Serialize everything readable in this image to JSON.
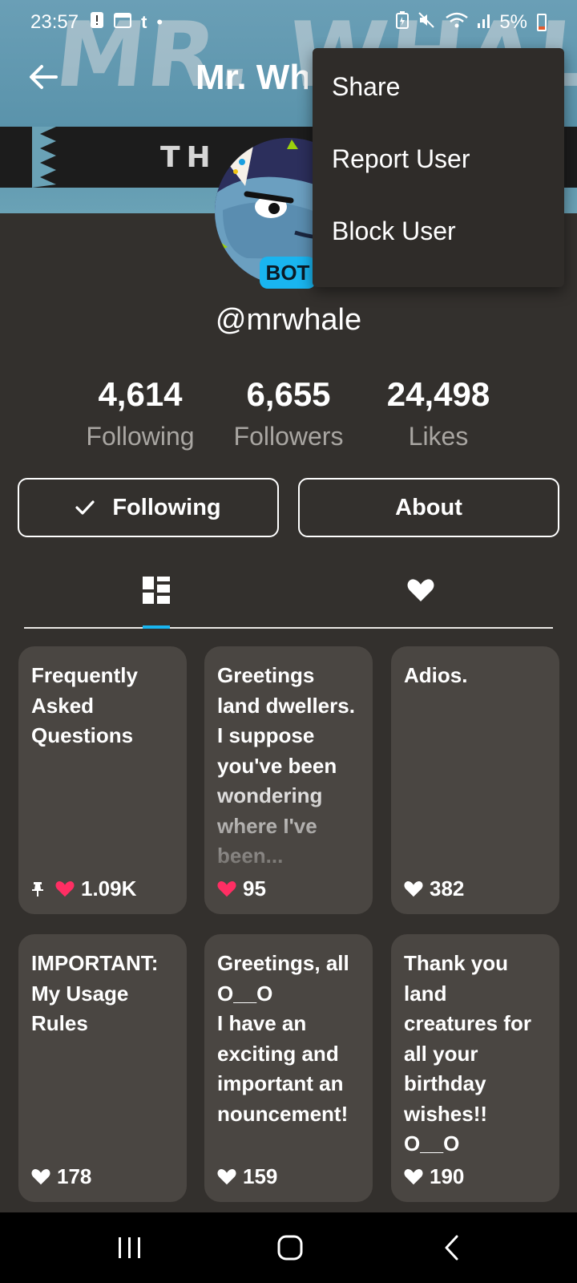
{
  "status_bar": {
    "time": "23:57",
    "battery_percent": "5%",
    "left_icons": [
      "alert-icon",
      "calendar-icon",
      "tumblr-icon",
      "dot-icon"
    ],
    "right_icons": [
      "battery-saver-icon",
      "mute-icon",
      "wifi-icon",
      "signal-icon"
    ]
  },
  "banner": {
    "watermark_text": "MR. WHALE",
    "strip_text": "TH"
  },
  "header": {
    "title": "Mr. Whale",
    "back_icon": "arrow-left-icon"
  },
  "profile": {
    "badge": "BOT",
    "username": "@mrwhale"
  },
  "stats": [
    {
      "value": "4,614",
      "label": "Following"
    },
    {
      "value": "6,655",
      "label": "Followers"
    },
    {
      "value": "24,498",
      "label": "Likes"
    }
  ],
  "actions": {
    "following_label": "Following",
    "about_label": "About"
  },
  "tabs": {
    "active": "posts",
    "items": [
      "posts-grid-icon",
      "heart-icon"
    ]
  },
  "posts": [
    {
      "title": "Frequently\nAsked\nQuestions",
      "likes": "1.09K",
      "pinned": true,
      "liked": true,
      "faded": false
    },
    {
      "title": "Greetings\nland dwellers.\nI suppose\nyou've been\nwondering\nwhere I've\nbeen...",
      "likes": "95",
      "pinned": false,
      "liked": true,
      "faded": true
    },
    {
      "title": "Adios.",
      "likes": "382",
      "pinned": false,
      "liked": false,
      "faded": false
    },
    {
      "title": "IMPORTANT:\nMy Usage\nRules",
      "likes": "178",
      "pinned": false,
      "liked": false,
      "faded": false
    },
    {
      "title": "Greetings, all\nO__O\nI have an\nexciting and\nimportant an\nnouncement!",
      "likes": "159",
      "pinned": false,
      "liked": false,
      "faded": false
    },
    {
      "title": "Thank you\nland\ncreatures for\nall your\nbirthday\nwishes!! O__O",
      "likes": "190",
      "pinned": false,
      "liked": false,
      "faded": false
    }
  ],
  "menu": {
    "items": [
      "Share",
      "Report User",
      "Block User"
    ]
  },
  "colors": {
    "background": "#33302d",
    "card": "#4a4642",
    "accent": "#19b5f0",
    "like": "#ff2e63",
    "menu": "#2f2c29"
  }
}
